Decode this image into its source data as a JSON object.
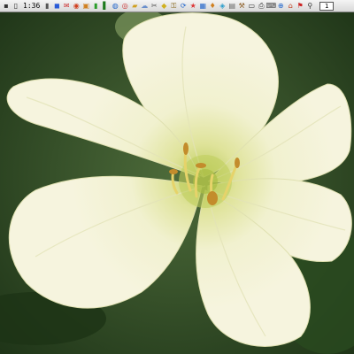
{
  "taskbar": {
    "clock": "1:36",
    "page_indicator": "1",
    "leading_icons": [
      {
        "name": "quick-launch-box-icon",
        "glyph": "▪",
        "color": "#333333"
      },
      {
        "name": "monitor-icon",
        "glyph": "▯",
        "color": "#222222"
      }
    ],
    "trailing_icons": [
      {
        "name": "phone-icon",
        "glyph": "▮",
        "color": "#555555"
      },
      {
        "name": "blue-app-icon",
        "glyph": "◼",
        "color": "#2a5bd7"
      },
      {
        "name": "mail-icon",
        "glyph": "✉",
        "color": "#cc3333"
      },
      {
        "name": "red-app-icon",
        "glyph": "◉",
        "color": "#d04020"
      },
      {
        "name": "image-icon",
        "glyph": "▣",
        "color": "#d08020"
      },
      {
        "name": "battery-icon",
        "glyph": "▮",
        "color": "#2a9d2a"
      },
      {
        "name": "signal-icon",
        "glyph": "▌",
        "color": "#1d7a1d"
      },
      {
        "name": "globe-icon",
        "glyph": "◍",
        "color": "#2266cc"
      },
      {
        "name": "disc-icon",
        "glyph": "◎",
        "color": "#cc3333"
      },
      {
        "name": "folder-icon",
        "glyph": "▰",
        "color": "#d0a020"
      },
      {
        "name": "cloud-icon",
        "glyph": "☁",
        "color": "#6a8fcc"
      },
      {
        "name": "tools-icon",
        "glyph": "✂",
        "color": "#555555"
      },
      {
        "name": "lightbulb-icon",
        "glyph": "◆",
        "color": "#d0b020"
      },
      {
        "name": "key-icon",
        "glyph": "⚿",
        "color": "#8a6a20"
      },
      {
        "name": "sync-icon",
        "glyph": "⟳",
        "color": "#2266cc"
      },
      {
        "name": "star-icon",
        "glyph": "★",
        "color": "#dd3333"
      },
      {
        "name": "chart-icon",
        "glyph": "▦",
        "color": "#2a6acc"
      },
      {
        "name": "bell-icon",
        "glyph": "♦",
        "color": "#d08020"
      },
      {
        "name": "paint-icon",
        "glyph": "◈",
        "color": "#2a9dcc"
      },
      {
        "name": "document-icon",
        "glyph": "▤",
        "color": "#666666"
      },
      {
        "name": "wrench-icon",
        "glyph": "⚒",
        "color": "#8a5a20"
      },
      {
        "name": "display-icon",
        "glyph": "▭",
        "color": "#333333"
      },
      {
        "name": "printer-icon",
        "glyph": "⎙",
        "color": "#444444"
      },
      {
        "name": "keyboard-icon",
        "glyph": "⌨",
        "color": "#444444"
      },
      {
        "name": "network-icon",
        "glyph": "⊕",
        "color": "#2266cc"
      },
      {
        "name": "home-icon",
        "glyph": "⌂",
        "color": "#c04020"
      },
      {
        "name": "flag-icon",
        "glyph": "⚑",
        "color": "#cc2222"
      },
      {
        "name": "search-icon",
        "glyph": "⚲",
        "color": "#333333"
      }
    ]
  },
  "colors": {
    "background": "#2f4a26",
    "petal": "#f3f3d2",
    "petal_vein": "#e0e2b0",
    "throat": "#c9d66a",
    "stamen": "#e8cf5a",
    "anther": "#c08a2a"
  }
}
